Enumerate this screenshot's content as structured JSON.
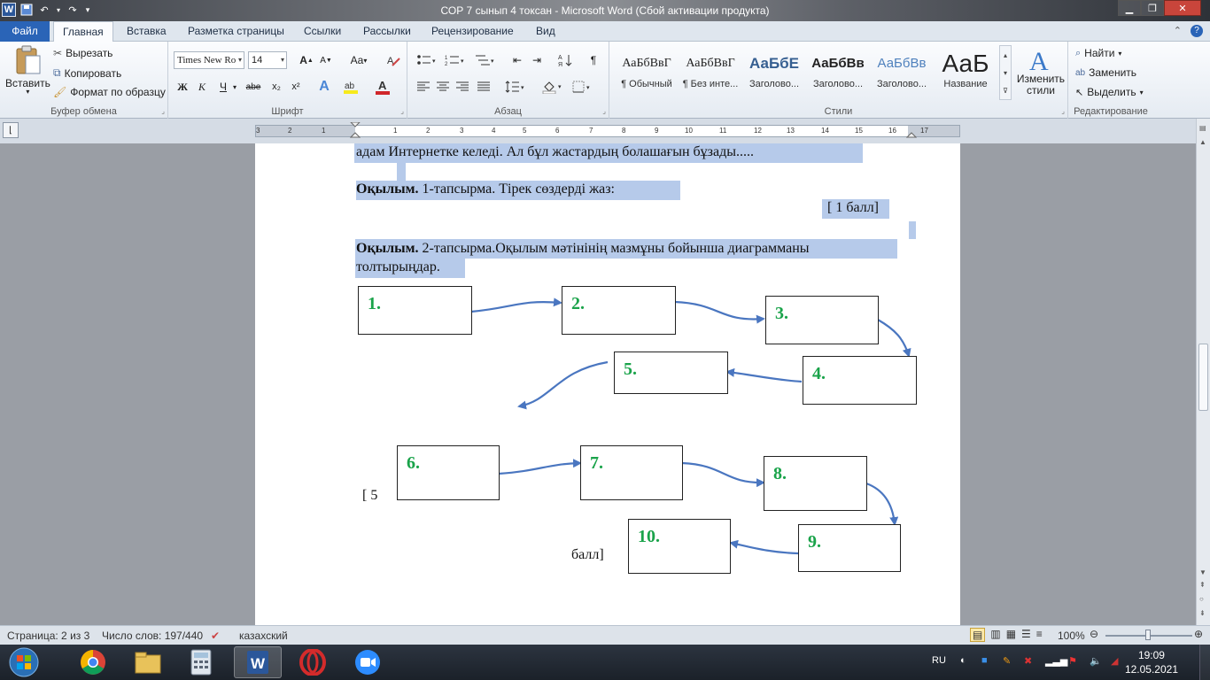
{
  "window": {
    "title": "СОР 7 сынып 4 токсан  -  Microsoft Word (Сбой активации продукта)"
  },
  "tabs": [
    "Файл",
    "Главная",
    "Вставка",
    "Разметка страницы",
    "Ссылки",
    "Рассылки",
    "Рецензирование",
    "Вид"
  ],
  "clipboard": {
    "paste": "Вставить",
    "cut": "Вырезать",
    "copy": "Копировать",
    "format_painter": "Формат по образцу",
    "label": "Буфер обмена"
  },
  "font": {
    "name": "Times New Ro",
    "size": "14",
    "label": "Шрифт",
    "change_case": "Aa",
    "grow": "A",
    "shrink": "A",
    "bold": "Ж",
    "italic": "К",
    "underline": "Ч",
    "strike": "abe",
    "subscript": "x₂",
    "superscript": "x²",
    "font_color": "A"
  },
  "paragraph": {
    "label": "Абзац",
    "pilcrow": "¶"
  },
  "styles": {
    "label": "Стили",
    "items": [
      {
        "sample": "АаБбВвГ",
        "name": "¶ Обычный"
      },
      {
        "sample": "АаБбВвГ",
        "name": "¶ Без инте..."
      },
      {
        "sample": "АаБбЕ",
        "name": "Заголово..."
      },
      {
        "sample": "АаБбВв",
        "name": "Заголово..."
      },
      {
        "sample": "АаБбВв",
        "name": "Заголово..."
      },
      {
        "sample": "АаБ",
        "name": "Название"
      }
    ],
    "change_styles": "Изменить стили"
  },
  "editing": {
    "find": "Найти",
    "replace": "Заменить",
    "select": "Выделить",
    "label": "Редактирование"
  },
  "ruler": [
    "3",
    "2",
    "1",
    "1",
    "2",
    "3",
    "4",
    "5",
    "6",
    "7",
    "8",
    "9",
    "10",
    "11",
    "12",
    "13",
    "14",
    "15",
    "16",
    "17"
  ],
  "document": {
    "line1": "адам Интернетке келеді.  Ал бұл жастардың болашағын бұзады.....",
    "task1_bold": "Оқылым.",
    "task1_rest": " 1-тапсырма. Тірек сөздерді жаз:",
    "score1": "[ 1 балл]",
    "task2_bold": "Оқылым.",
    "task2_rest": " 2-тапсырма.Оқылым  мәтінінің  мазмұны бойынша диаграмманы",
    "task2_line2": "толтырыңдар.",
    "boxes": [
      "1.",
      "2.",
      "3.",
      "4.",
      "5.",
      "6.",
      "7.",
      "8.",
      "9.",
      "10."
    ],
    "score2_a": "[ 5",
    "score2_b": "балл]"
  },
  "status": {
    "page": "Страница: 2 из 3",
    "words": "Число слов: 197/440",
    "lang": "казахский",
    "zoom": "100%"
  },
  "taskbar": {
    "lang": "RU",
    "time": "19:09",
    "date": "12.05.2021"
  },
  "colors": {
    "selection": "#b6caea",
    "number_green": "#1aa34a",
    "arrow_blue": "#4a76c0",
    "file_tab": "#2a64b7"
  }
}
